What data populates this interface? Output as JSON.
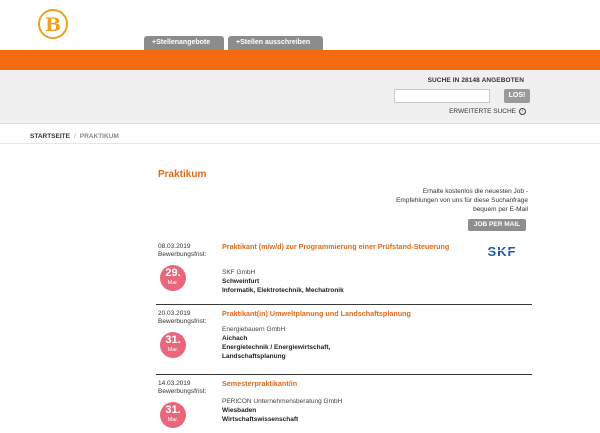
{
  "header": {
    "logo_letter": "B",
    "tabs": [
      "+Stellenangebote",
      "+Stellen ausschreiben"
    ],
    "brand_color": "#f26b0f"
  },
  "search": {
    "label": "SUCHE IN 28148 ANGEBOTEN",
    "input_value": "",
    "button": "LOS!",
    "advanced": "ERWEITERTE SUCHE"
  },
  "breadcrumb": {
    "home": "STARTSEITE",
    "separator": "/",
    "current": "PRAKTIKUM"
  },
  "page": {
    "title": "Praktikum",
    "mail_text_1": "Erhalte kostenlos die neuesten Job -",
    "mail_text_2": "Empfehlungen von uns für diese Suchanfrage",
    "mail_text_3": "bequem per E-Mail",
    "mail_button": "JOB PER MAIL"
  },
  "jobs": [
    {
      "date": "08.03.2019",
      "deadline_label": "Bewerbungsfrist:",
      "day": "29.",
      "month": "Mar.",
      "title": "Praktikant (m/w/d) zur Programmierung einer Prüfstand-Steuerung",
      "company": "SKF GmbH",
      "city": "Schweinfurt",
      "field": "Informatik, Elektrotechnik, Mechatronik",
      "logo": "SKF"
    },
    {
      "date": "20.03.2019",
      "deadline_label": "Bewerbungsfrist:",
      "day": "31.",
      "month": "Mar.",
      "title": "Praktikant(in) Umweltplanung und Landschaftsplanung",
      "company": "Energiebauern GmbH",
      "city": "Aichach",
      "field": "Energietechnik / Energiewirtschaft,",
      "field2": "Landschaftsplanung"
    },
    {
      "date": "14.03.2019",
      "deadline_label": "Bewerbungsfrist:",
      "day": "31.",
      "month": "Mar.",
      "title": "Semesterpraktikant/in",
      "company": "PERICON Unternehmensberatung GmbH",
      "city": "Wiesbaden",
      "field": "Wirtschaftswissenschaft"
    }
  ]
}
